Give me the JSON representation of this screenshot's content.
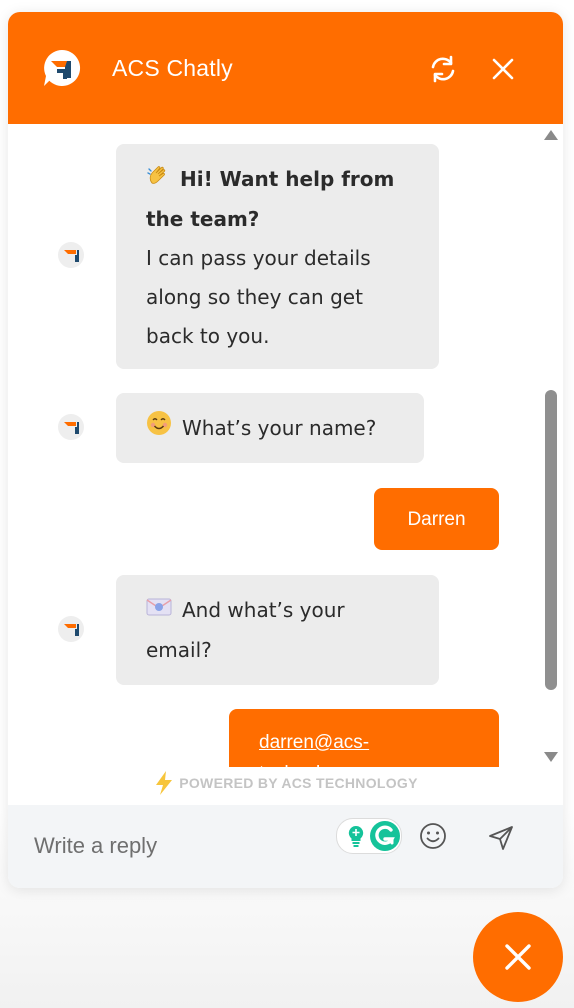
{
  "header": {
    "title": "ACS Chatly",
    "refresh_icon": "refresh-icon",
    "close_icon": "close-icon"
  },
  "messages": [
    {
      "from": "bot",
      "emoji": "waving-hand-icon",
      "bold": "Hi! Want help from the team?",
      "text": "I can pass your details along so they can get back to you."
    },
    {
      "from": "bot",
      "emoji": "smiling-face-icon",
      "text": "What’s your name?"
    },
    {
      "from": "user",
      "text": "Darren"
    },
    {
      "from": "bot",
      "emoji": "envelope-icon",
      "text": "And what’s your email?"
    },
    {
      "from": "user",
      "link": "darren@acs-technology.com"
    }
  ],
  "powered_by": "POWERED BY ACS TECHNOLOGY",
  "footer": {
    "placeholder": "Write a reply",
    "emoji_icon": "emoji-icon",
    "send_icon": "send-icon"
  },
  "colors": {
    "brand": "#ff6d00",
    "bot_bubble": "#ececec",
    "footer_bg": "#f3f5f7"
  }
}
